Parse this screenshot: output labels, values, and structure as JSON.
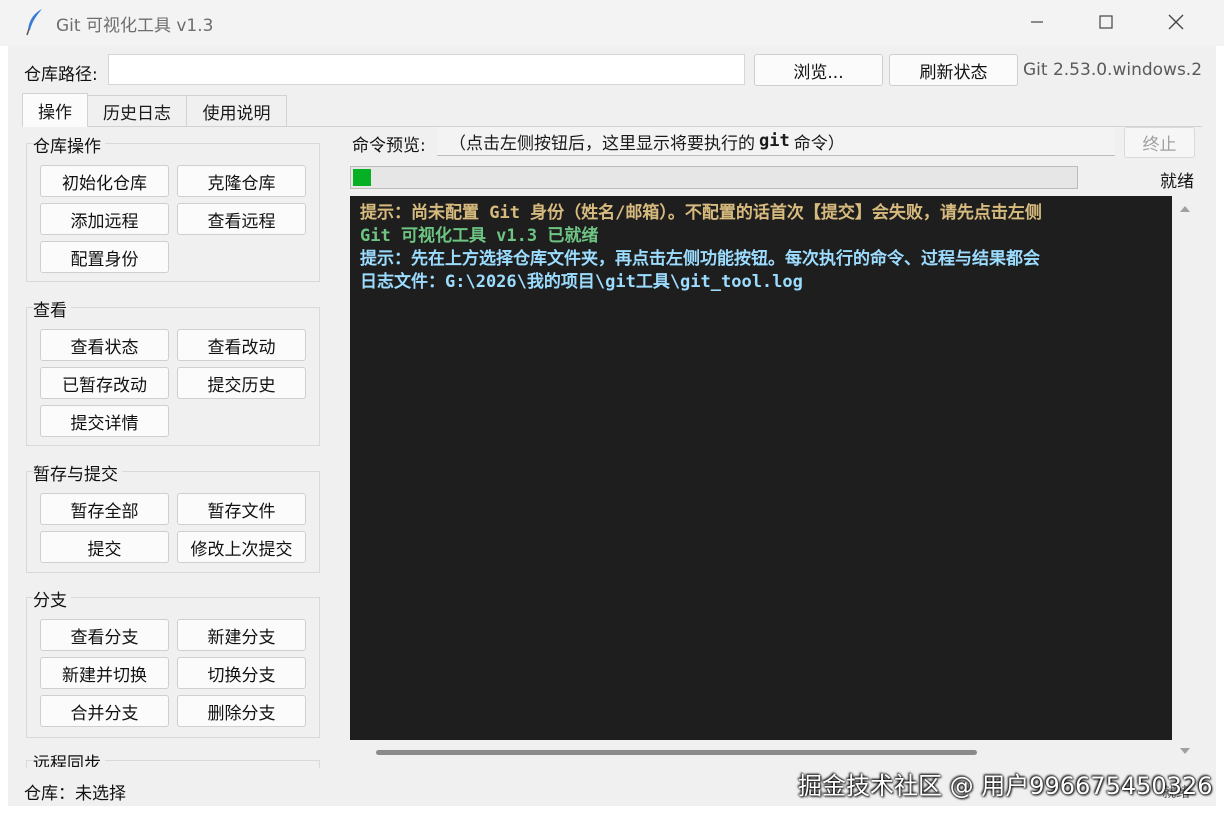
{
  "window": {
    "title": "Git 可视化工具 v1.3",
    "controls": [
      "minimize",
      "maximize",
      "close"
    ]
  },
  "toolbar": {
    "path_label": "仓库路径:",
    "path_value": "",
    "browse_label": "浏览...",
    "refresh_label": "刷新状态",
    "git_version": "Git 2.53.0.windows.2"
  },
  "tabs": [
    {
      "label": "操作",
      "active": true
    },
    {
      "label": "历史日志",
      "active": false
    },
    {
      "label": "使用说明",
      "active": false
    }
  ],
  "groups": [
    {
      "title": "仓库操作",
      "buttons": [
        "初始化仓库",
        "克隆仓库",
        "添加远程",
        "查看远程",
        "配置身份"
      ]
    },
    {
      "title": "查看",
      "buttons": [
        "查看状态",
        "查看改动",
        "已暂存改动",
        "提交历史",
        "提交详情"
      ]
    },
    {
      "title": "暂存与提交",
      "buttons": [
        "暂存全部",
        "暂存文件",
        "提交",
        "修改上次提交"
      ]
    },
    {
      "title": "分支",
      "buttons": [
        "查看分支",
        "新建分支",
        "新建并切换",
        "切换分支",
        "合并分支",
        "删除分支"
      ]
    },
    {
      "title": "远程同步",
      "buttons": []
    }
  ],
  "command": {
    "label": "命令预览:",
    "preview_prefix": "（点击左侧按钮后，这里显示将要执行的",
    "preview_keyword": "git",
    "preview_suffix": "命令）",
    "stop_label": "终止"
  },
  "progress": {
    "value": 0.025,
    "status": "就绪"
  },
  "console": {
    "lines": [
      {
        "text": "提示：尚未配置 Git 身份（姓名/邮箱）。不配置的话首次【提交】会失败，请先点击左侧",
        "color": "#d7ba7d"
      },
      {
        "text": "Git 可视化工具 v1.3 已就绪",
        "color": "#6dc483"
      },
      {
        "text": "提示：先在上方选择仓库文件夹，再点击左侧功能按钮。每次执行的命令、过程与结果都会",
        "color": "#9cdcfe"
      },
      {
        "text": "日志文件：G:\\2026\\我的项目\\git工具\\git_tool.log",
        "color": "#9cdcfe"
      }
    ]
  },
  "statusbar": {
    "repo_label": "仓库：未选择",
    "right": "就绪"
  },
  "watermark": "掘金技术社区 @ 用户996675450326",
  "colors": {
    "console_bg": "#1e1e1e",
    "progress_fill": "#06b025",
    "window_bg": "#f0f0f0"
  }
}
